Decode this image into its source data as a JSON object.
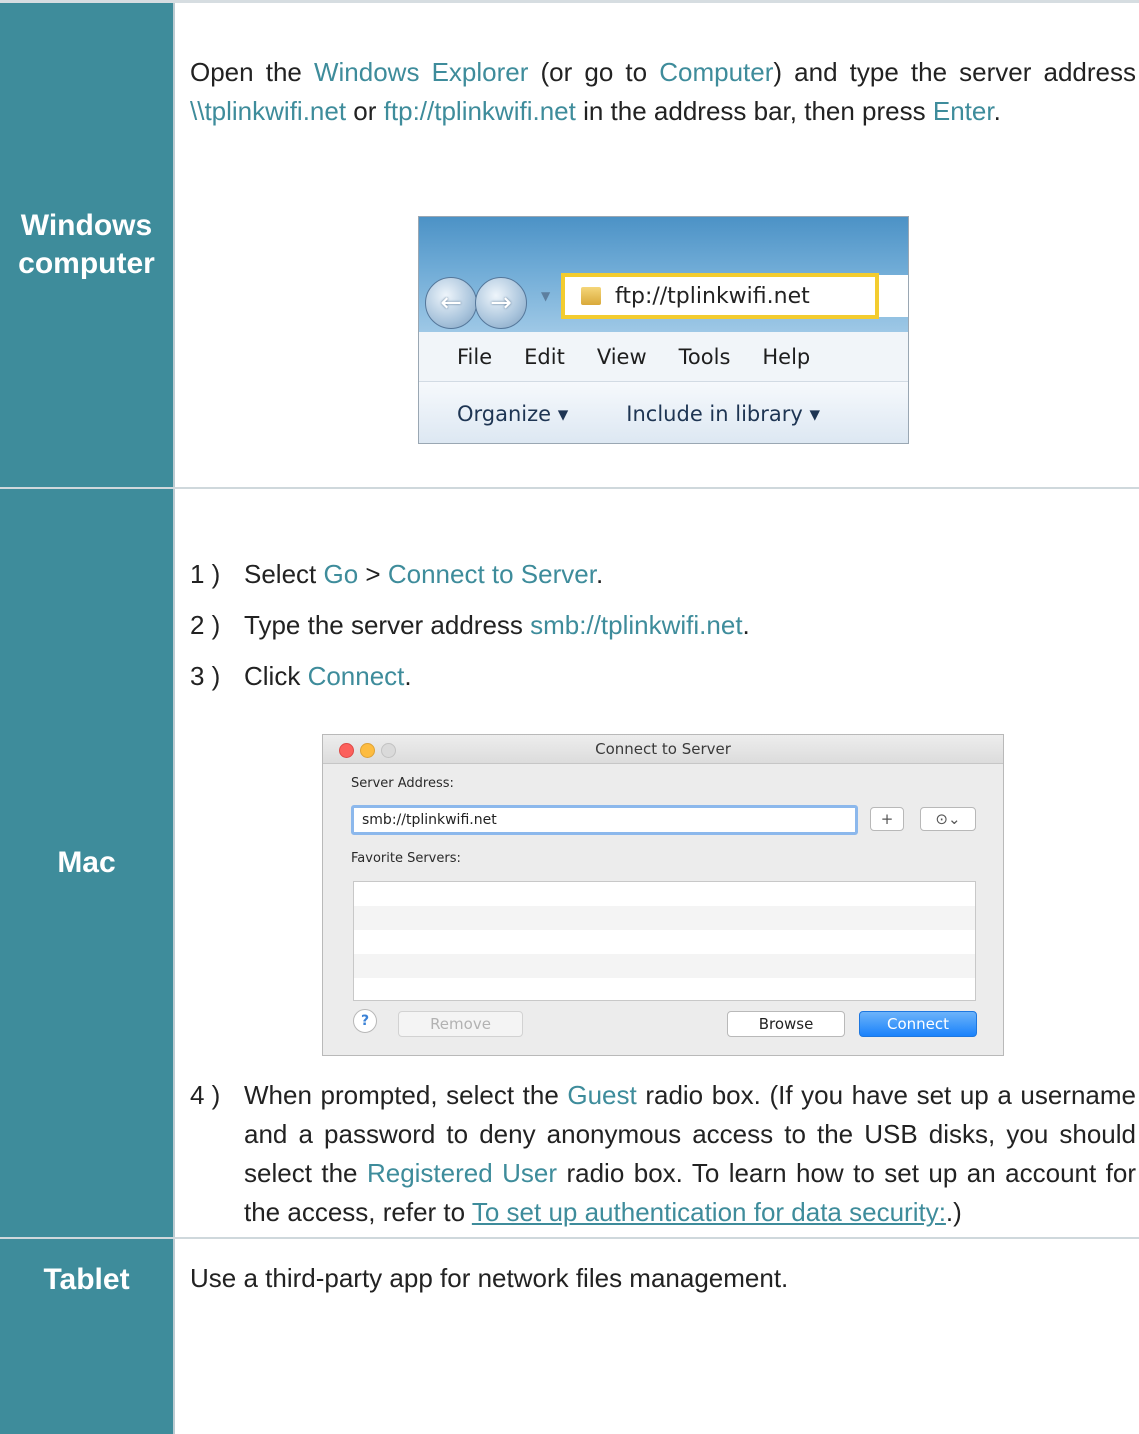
{
  "rows": {
    "windows": {
      "label": "Windows computer",
      "text": {
        "t1": "Open the ",
        "h1": "Windows Explorer",
        "t2": " (or go to ",
        "h2": "Computer",
        "t3": ") and type the server address ",
        "h3": "\\\\tplinkwifi.net",
        "t4": " or ",
        "h4": "ftp://tplinkwifi.net",
        "t5": " in the address bar, then press ",
        "h5": "Enter",
        "t6": "."
      },
      "explorer": {
        "address": "ftp://tplinkwifi.net",
        "menu": [
          "File",
          "Edit",
          "View",
          "Tools",
          "Help"
        ],
        "commands": [
          "Organize ▾",
          "Include in library ▾"
        ],
        "back_icon": "back-arrow-icon",
        "forward_icon": "forward-arrow-icon",
        "folder_icon": "folder-icon"
      }
    },
    "mac": {
      "label": "Mac",
      "steps": {
        "s1": {
          "num": "1 )",
          "t1": "Select ",
          "h1": "Go",
          "t2": " > ",
          "h2": "Connect to Server",
          "t3": "."
        },
        "s2": {
          "num": "2 )",
          "t1": "Type the server address ",
          "h1": "smb://tplinkwifi.net",
          "t2": "."
        },
        "s3": {
          "num": "3 )",
          "t1": "Click ",
          "h1": "Connect",
          "t2": "."
        },
        "s4": {
          "num": "4 )",
          "t1": "When prompted, select the ",
          "h1": "Guest",
          "t2": " radio box. (If you have set up a username and a password to deny anonymous access to the USB disks, you should select the ",
          "h2": "Registered User",
          "t3": " radio box. To learn how to set up an account for the access, refer to ",
          "link": "To set up authentication for data security:",
          "t4": ".)"
        }
      },
      "dialog": {
        "title": "Connect to Server",
        "server_label": "Server Address:",
        "server_value": "smb://tplinkwifi.net",
        "plus": "+",
        "history": "⊙⌄",
        "favorites_label": "Favorite Servers:",
        "help": "?",
        "remove": "Remove",
        "browse": "Browse",
        "connect": "Connect"
      }
    },
    "tablet": {
      "label": "Tablet",
      "text": "Use a third-party app for network files management."
    }
  },
  "colors": {
    "accent": "#3e8c9b",
    "label_bg": "#3e8c9b"
  }
}
